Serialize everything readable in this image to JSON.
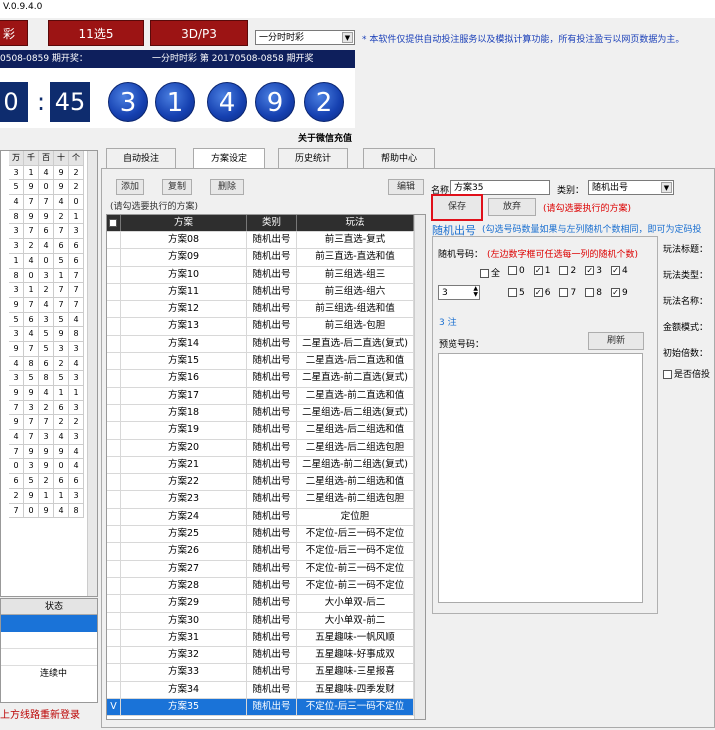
{
  "app": {
    "version": "V.0.9.4.0"
  },
  "lottery_buttons": [
    "彩",
    "11选5",
    "3D/P3"
  ],
  "lottery_select": "一分时时彩",
  "notice": "* 本软件仅提供自动投注服务以及模拟计算功能，所有投注盈亏以网页数据为主。",
  "draw": {
    "current_period": "0508-0859 期开奖：",
    "last_period": "一分时时彩 第 20170508-0858 期开奖",
    "timer": [
      "0",
      ":",
      "45"
    ],
    "balls": [
      "3",
      "1",
      "4",
      "9",
      "2"
    ],
    "wechat": "关于微信充值"
  },
  "left_grid": {
    "headers": [
      "万",
      "千",
      "百",
      "十",
      "个"
    ],
    "rows": [
      [
        "3",
        "1",
        "4",
        "9",
        "2"
      ],
      [
        "5",
        "9",
        "0",
        "9",
        "2"
      ],
      [
        "4",
        "7",
        "7",
        "4",
        "0"
      ],
      [
        "8",
        "9",
        "9",
        "2",
        "1"
      ],
      [
        "3",
        "7",
        "6",
        "7",
        "3"
      ],
      [
        "3",
        "2",
        "4",
        "6",
        "6"
      ],
      [
        "1",
        "4",
        "0",
        "5",
        "6"
      ],
      [
        "8",
        "0",
        "3",
        "1",
        "7"
      ],
      [
        "3",
        "1",
        "2",
        "7",
        "7"
      ],
      [
        "9",
        "7",
        "4",
        "7",
        "7"
      ],
      [
        "5",
        "6",
        "3",
        "5",
        "4"
      ],
      [
        "3",
        "4",
        "5",
        "9",
        "8"
      ],
      [
        "9",
        "7",
        "5",
        "3",
        "3"
      ],
      [
        "4",
        "8",
        "6",
        "2",
        "4"
      ],
      [
        "3",
        "5",
        "8",
        "5",
        "3"
      ],
      [
        "9",
        "9",
        "4",
        "1",
        "1"
      ],
      [
        "7",
        "3",
        "2",
        "6",
        "3"
      ],
      [
        "9",
        "7",
        "7",
        "2",
        "2"
      ],
      [
        "4",
        "7",
        "3",
        "4",
        "3"
      ],
      [
        "7",
        "9",
        "9",
        "9",
        "4"
      ],
      [
        "0",
        "3",
        "9",
        "0",
        "4"
      ],
      [
        "6",
        "5",
        "2",
        "6",
        "6"
      ],
      [
        "2",
        "9",
        "1",
        "1",
        "3"
      ],
      [
        "7",
        "0",
        "9",
        "4",
        "8"
      ]
    ],
    "state_header": "状态",
    "state_row": "连续中"
  },
  "login_message": "上方线路重新登录",
  "tabs": [
    "自动投注",
    "方案设定",
    "历史统计",
    "帮助中心"
  ],
  "toolbar": {
    "add": "添加",
    "copy": "复制",
    "delete": "删除",
    "edit": "编辑"
  },
  "hint_select": "(请勾选要执行的方案)",
  "grid": {
    "headers": [
      "方案",
      "类别",
      "玩法"
    ],
    "rows": [
      {
        "check": "",
        "name": "方案08",
        "cat": "随机出号",
        "play": "前三直选-复式"
      },
      {
        "check": "",
        "name": "方案09",
        "cat": "随机出号",
        "play": "前三直选-直选和值"
      },
      {
        "check": "",
        "name": "方案10",
        "cat": "随机出号",
        "play": "前三组选-组三"
      },
      {
        "check": "",
        "name": "方案11",
        "cat": "随机出号",
        "play": "前三组选-组六"
      },
      {
        "check": "",
        "name": "方案12",
        "cat": "随机出号",
        "play": "前三组选-组选和值"
      },
      {
        "check": "",
        "name": "方案13",
        "cat": "随机出号",
        "play": "前三组选-包胆"
      },
      {
        "check": "",
        "name": "方案14",
        "cat": "随机出号",
        "play": "二星直选-后二直选(复式)"
      },
      {
        "check": "",
        "name": "方案15",
        "cat": "随机出号",
        "play": "二星直选-后二直选和值"
      },
      {
        "check": "",
        "name": "方案16",
        "cat": "随机出号",
        "play": "二星直选-前二直选(复式)"
      },
      {
        "check": "",
        "name": "方案17",
        "cat": "随机出号",
        "play": "二星直选-前二直选和值"
      },
      {
        "check": "",
        "name": "方案18",
        "cat": "随机出号",
        "play": "二星组选-后二组选(复式)"
      },
      {
        "check": "",
        "name": "方案19",
        "cat": "随机出号",
        "play": "二星组选-后二组选和值"
      },
      {
        "check": "",
        "name": "方案20",
        "cat": "随机出号",
        "play": "二星组选-后二组选包胆"
      },
      {
        "check": "",
        "name": "方案21",
        "cat": "随机出号",
        "play": "二星组选-前二组选(复式)"
      },
      {
        "check": "",
        "name": "方案22",
        "cat": "随机出号",
        "play": "二星组选-前二组选和值"
      },
      {
        "check": "",
        "name": "方案23",
        "cat": "随机出号",
        "play": "二星组选-前二组选包胆"
      },
      {
        "check": "",
        "name": "方案24",
        "cat": "随机出号",
        "play": "定位胆"
      },
      {
        "check": "",
        "name": "方案25",
        "cat": "随机出号",
        "play": "不定位-后三一码不定位"
      },
      {
        "check": "",
        "name": "方案26",
        "cat": "随机出号",
        "play": "不定位-后三一码不定位"
      },
      {
        "check": "",
        "name": "方案27",
        "cat": "随机出号",
        "play": "不定位-前三一码不定位"
      },
      {
        "check": "",
        "name": "方案28",
        "cat": "随机出号",
        "play": "不定位-前三一码不定位"
      },
      {
        "check": "",
        "name": "方案29",
        "cat": "随机出号",
        "play": "大小单双-后二"
      },
      {
        "check": "",
        "name": "方案30",
        "cat": "随机出号",
        "play": "大小单双-前二"
      },
      {
        "check": "",
        "name": "方案31",
        "cat": "随机出号",
        "play": "五星趣味-一帆风顺"
      },
      {
        "check": "",
        "name": "方案32",
        "cat": "随机出号",
        "play": "五星趣味-好事成双"
      },
      {
        "check": "",
        "name": "方案33",
        "cat": "随机出号",
        "play": "五星趣味-三星报喜"
      },
      {
        "check": "",
        "name": "方案34",
        "cat": "随机出号",
        "play": "五星趣味-四季发财"
      },
      {
        "check": "V",
        "name": "方案35",
        "cat": "随机出号",
        "play": "不定位-后三一码不定位"
      }
    ]
  },
  "form": {
    "name_label": "名称：",
    "name_value": "方案35",
    "category_label": "类别：",
    "category_value": "随机出号",
    "save": "保存",
    "discard": "放弃",
    "hint_select": "(请勾选要执行的方案)",
    "random_title": "随机出号",
    "random_hint": "(勾选号码数量如果与左列随机个数相同，即可为定码投",
    "random_label": "随机号码：",
    "random_sub": "(左边数字框可任选每一列的随机个数)",
    "all_label": "全",
    "digits_row1": [
      {
        "n": "0",
        "c": false
      },
      {
        "n": "1",
        "c": true
      },
      {
        "n": "2",
        "c": false
      },
      {
        "n": "3",
        "c": true
      },
      {
        "n": "4",
        "c": true
      }
    ],
    "digits_row2": [
      {
        "n": "5",
        "c": false
      },
      {
        "n": "6",
        "c": true
      },
      {
        "n": "7",
        "c": false
      },
      {
        "n": "8",
        "c": false
      },
      {
        "n": "9",
        "c": true
      }
    ],
    "count_value": "3",
    "bets": "3 注",
    "preview_label": "预览号码：",
    "refresh": "刷新",
    "side_labels": [
      "玩法标题：",
      "玩法类型：",
      "玩法名称：",
      "金额模式：",
      "初始倍数："
    ],
    "double_label": "是否倍投"
  }
}
